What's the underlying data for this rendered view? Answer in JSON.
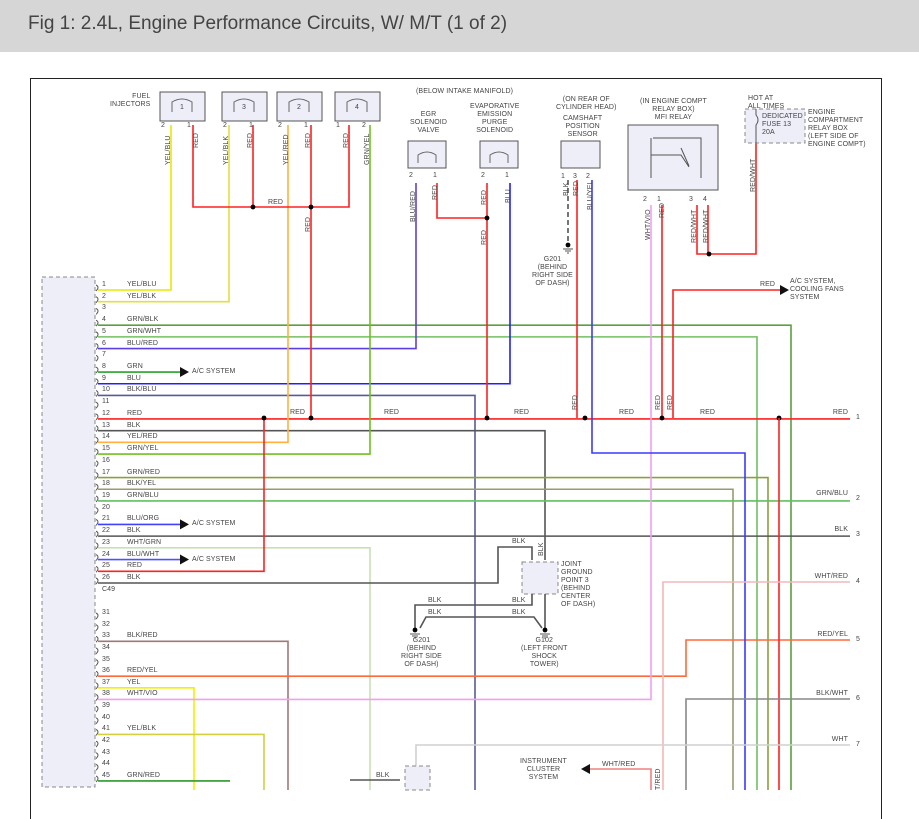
{
  "title": "Fig 1: 2.4L, Engine Performance Circuits, W/ M/T (1 of 2)",
  "components": {
    "injectors": {
      "label": "FUEL\nINJECTORS",
      "numbers": [
        "1",
        "3",
        "2",
        "4"
      ],
      "pins": [
        [
          "2",
          "1"
        ],
        [
          "2",
          "1"
        ],
        [
          "2",
          "1"
        ],
        [
          "1",
          "2"
        ]
      ],
      "wires": [
        "YEL/BLU",
        "RED",
        "YEL/BLK",
        "RED",
        "YEL/RED",
        "RED",
        "RED",
        "GRN/YEL"
      ],
      "bus_label": "RED",
      "bus_down_label": "RED"
    },
    "manifold_note": "(BELOW INTAKE MANIFOLD)",
    "egr": {
      "label": "EGR\nSOLENOID\nVALVE",
      "pins": [
        "2",
        "1"
      ],
      "wires": [
        "BLU/RED",
        "RED"
      ]
    },
    "evap": {
      "label": "EVAPORATIVE\nEMISSION\nPURGE\nSOLENOID",
      "pins": [
        "2",
        "1"
      ],
      "wires": [
        "RED",
        "BLU"
      ],
      "down_label": "RED"
    },
    "camshaft": {
      "note": "(ON REAR OF\nCYLINDER HEAD)",
      "label": "CAMSHAFT\nPOSITION\nSENSOR",
      "pins": [
        "1",
        "3",
        "2"
      ],
      "wires": [
        "BLK",
        "RED",
        "BLU/YEL"
      ],
      "ground": "G201\n(BEHIND\nRIGHT SIDE\nOF DASH)",
      "down_label": "RED"
    },
    "mfi_relay": {
      "note": "(IN ENGINE COMPT\nRELAY BOX)\nMFI RELAY",
      "pins": [
        "2",
        "1",
        "3",
        "4"
      ],
      "wires": [
        "WHT/VIO",
        "RED",
        "RED/WHT",
        "RED/WHT"
      ],
      "down_labels": [
        "RED",
        "RED"
      ]
    },
    "fuse": {
      "hot": "HOT AT\nALL TIMES",
      "label": "DEDICATED\nFUSE 13\n20A",
      "box": "ENGINE\nCOMPARTMENT\nRELAY BOX\n(LEFT SIDE OF\nENGINE COMPT)",
      "wire": "RED/WHT"
    },
    "ac_fans": {
      "wire": "RED",
      "label": "A/C SYSTEM,\nCOOLING FANS\nSYSTEM"
    },
    "joint": {
      "label": "JOINT\nGROUND\nPOINT 3\n(BEHIND\nCENTER\nOF DASH)",
      "wires": [
        "BLK",
        "BLK",
        "BLK",
        "BLK",
        "BLK",
        "BLK"
      ]
    },
    "g201": {
      "label": "G201\n(BEHIND\nRIGHT SIDE\nOF DASH)"
    },
    "g102": {
      "label": "G102\n(LEFT FRONT\nSHOCK\nTOWER)"
    },
    "cluster": {
      "label": "INSTRUMENT\nCLUSTER\nSYSTEM",
      "wire": "WHT/RED",
      "side_wire": "T/RED"
    },
    "bus_labels": [
      "RED",
      "RED",
      "RED",
      "RED",
      "RED"
    ],
    "lower_blk": "BLK"
  },
  "connector": {
    "name": "C49",
    "ac_label": "A/C SYSTEM",
    "pins": [
      {
        "pin": "1",
        "color": "YEL/BLU",
        "hex": "#e8e800"
      },
      {
        "pin": "2",
        "color": "YEL/BLK",
        "hex": "#e0e040"
      },
      {
        "pin": "3",
        "color": "",
        "hex": ""
      },
      {
        "pin": "4",
        "color": "GRN/BLK",
        "hex": "#5aa040"
      },
      {
        "pin": "5",
        "color": "GRN/WHT",
        "hex": "#70c060"
      },
      {
        "pin": "6",
        "color": "BLU/RED",
        "hex": "#5a40e0"
      },
      {
        "pin": "7",
        "color": "",
        "hex": ""
      },
      {
        "pin": "8",
        "color": "GRN",
        "hex": "#28a028"
      },
      {
        "pin": "9",
        "color": "BLU",
        "hex": "#2020ff"
      },
      {
        "pin": "10",
        "color": "BLK/BLU",
        "hex": "#5a5a9a"
      },
      {
        "pin": "11",
        "color": "",
        "hex": ""
      },
      {
        "pin": "12",
        "color": "RED",
        "hex": "#ff2020"
      },
      {
        "pin": "13",
        "color": "BLK",
        "hex": "#555555"
      },
      {
        "pin": "14",
        "color": "YEL/RED",
        "hex": "#ffb040"
      },
      {
        "pin": "15",
        "color": "GRN/YEL",
        "hex": "#70c020"
      },
      {
        "pin": "16",
        "color": "",
        "hex": ""
      },
      {
        "pin": "17",
        "color": "GRN/RED",
        "hex": "#8aa040"
      },
      {
        "pin": "18",
        "color": "BLK/YEL",
        "hex": "#9a9a70"
      },
      {
        "pin": "19",
        "color": "GRN/BLU",
        "hex": "#60c060"
      },
      {
        "pin": "20",
        "color": "",
        "hex": ""
      },
      {
        "pin": "21",
        "color": "BLU/ORG",
        "hex": "#4040ff"
      },
      {
        "pin": "22",
        "color": "BLK",
        "hex": "#555555"
      },
      {
        "pin": "23",
        "color": "WHT/GRN",
        "hex": "#c8e0b8"
      },
      {
        "pin": "24",
        "color": "BLU/WHT",
        "hex": "#5050ff"
      },
      {
        "pin": "25",
        "color": "RED",
        "hex": "#ff2020"
      },
      {
        "pin": "26",
        "color": "BLK",
        "hex": "#555555"
      },
      {
        "pin": "31",
        "color": "",
        "hex": ""
      },
      {
        "pin": "32",
        "color": "",
        "hex": ""
      },
      {
        "pin": "33",
        "color": "BLK/RED",
        "hex": "#a07878"
      },
      {
        "pin": "34",
        "color": "",
        "hex": ""
      },
      {
        "pin": "35",
        "color": "",
        "hex": ""
      },
      {
        "pin": "36",
        "color": "RED/YEL",
        "hex": "#ff6a3a"
      },
      {
        "pin": "37",
        "color": "YEL",
        "hex": "#f0f000"
      },
      {
        "pin": "38",
        "color": "WHT/VIO",
        "hex": "#f0a0f0"
      },
      {
        "pin": "39",
        "color": "",
        "hex": ""
      },
      {
        "pin": "40",
        "color": "",
        "hex": ""
      },
      {
        "pin": "41",
        "color": "YEL/BLK",
        "hex": "#d0d040"
      },
      {
        "pin": "42",
        "color": "",
        "hex": ""
      },
      {
        "pin": "43",
        "color": "",
        "hex": ""
      },
      {
        "pin": "44",
        "color": "",
        "hex": ""
      },
      {
        "pin": "45",
        "color": "GRN/RED",
        "hex": "#2a9a2a"
      }
    ]
  },
  "right_terminals": [
    {
      "num": "1",
      "color": "RED",
      "hex": "#ff2020"
    },
    {
      "num": "2",
      "color": "GRN/BLU",
      "hex": "#60c060"
    },
    {
      "num": "3",
      "color": "BLK",
      "hex": "#555555"
    },
    {
      "num": "4",
      "color": "WHT/RED",
      "hex": "#f4b8b8"
    },
    {
      "num": "5",
      "color": "RED/YEL",
      "hex": "#ff6a3a"
    },
    {
      "num": "6",
      "color": "BLK/WHT",
      "hex": "#555555"
    },
    {
      "num": "7",
      "color": "WHT",
      "hex": "#d0d0d0"
    }
  ]
}
